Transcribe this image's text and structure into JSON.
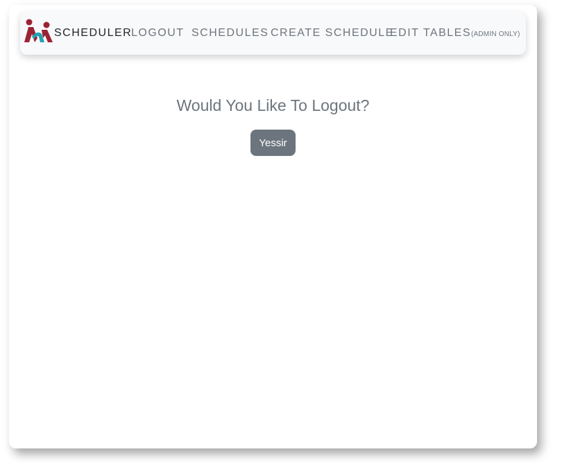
{
  "nav": {
    "brand": "SCHEDULER",
    "links": [
      {
        "label": "LOGOUT"
      },
      {
        "label": "SCHEDULES"
      },
      {
        "label": "CREATE SCHEDULE"
      },
      {
        "label": "EDIT TABLES",
        "suffix": "(ADMIN ONLY)"
      }
    ]
  },
  "main": {
    "heading": "Would You Like To Logout?",
    "confirm_button": "Yessir"
  },
  "colors": {
    "navbar_bg": "#f8f9fa",
    "text_muted": "#6c757d",
    "button_bg": "#6c757d",
    "logo_red": "#9b2335",
    "logo_teal": "#1fa3b0"
  }
}
